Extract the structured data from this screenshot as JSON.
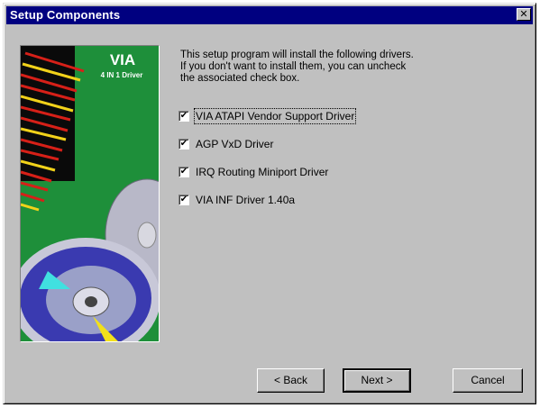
{
  "window": {
    "title": "Setup Components",
    "close_glyph": "✕"
  },
  "banner": {
    "brand": "VIA",
    "subtitle": "4 IN 1 Driver",
    "colors": {
      "background": "#1e8f3a",
      "streak_red": "#d62018",
      "streak_yellow": "#f2d21a",
      "disc": "#b8b8c8"
    }
  },
  "intro": {
    "line1": "This setup program will install  the following drivers.",
    "line2": " If you don't want to install them, you can uncheck",
    "line3": " the associated check box."
  },
  "options": [
    {
      "label": "VIA ATAPI Vendor Support Driver",
      "checked": true,
      "mark": "✔"
    },
    {
      "label": "AGP VxD Driver",
      "checked": true,
      "mark": "✔"
    },
    {
      "label": "IRQ Routing Miniport Driver",
      "checked": true,
      "mark": "✔"
    },
    {
      "label": "VIA INF Driver 1.40a",
      "checked": true,
      "mark": "✔"
    }
  ],
  "buttons": {
    "back": "< Back",
    "next": "Next >",
    "cancel": "Cancel"
  }
}
